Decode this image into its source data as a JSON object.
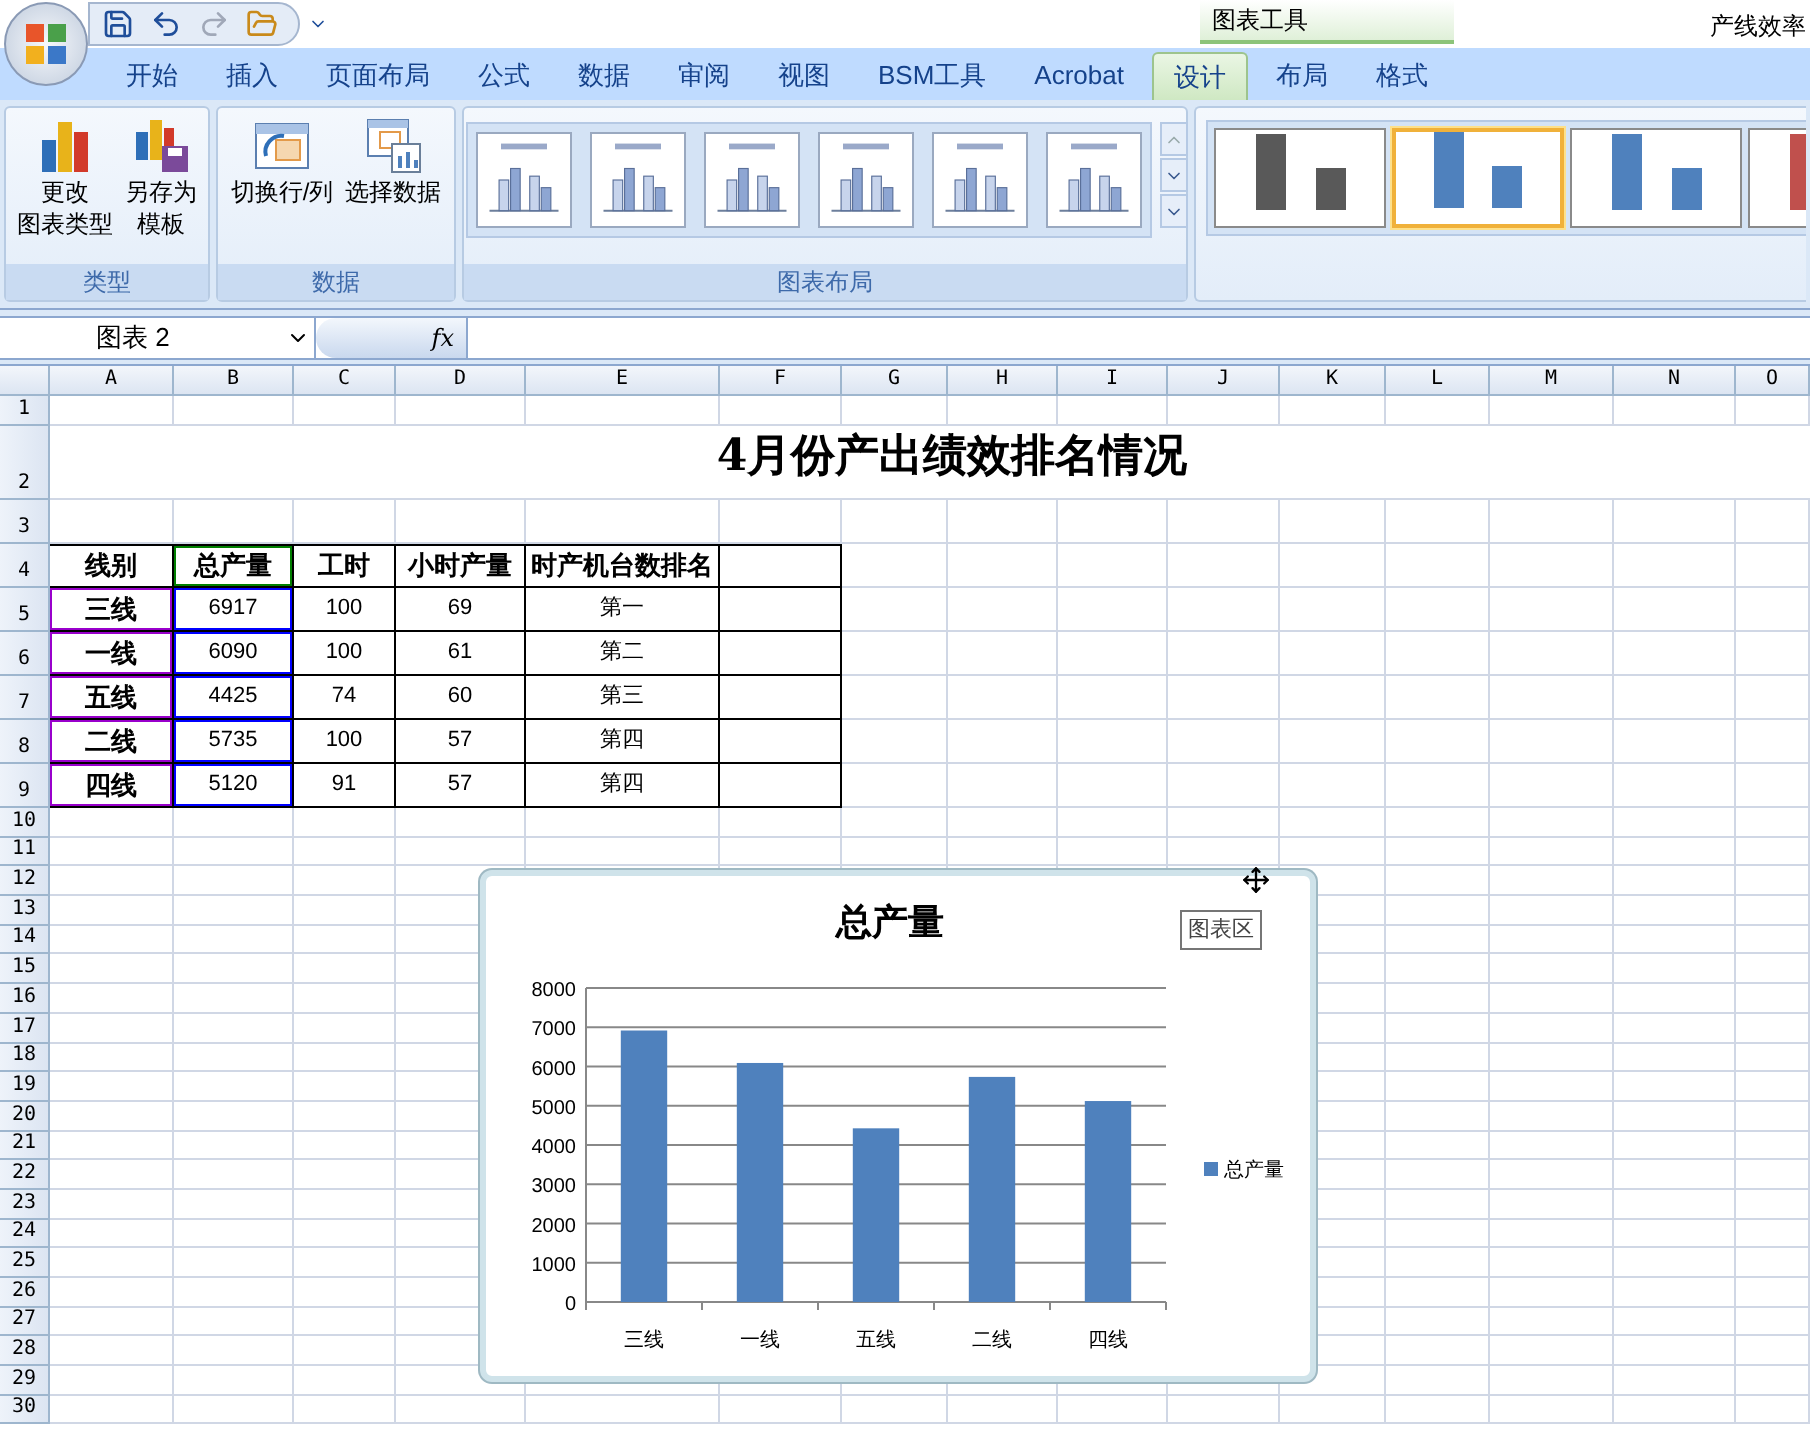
{
  "window": {
    "title": "产线效率",
    "context_tab_group": "图表工具"
  },
  "quick_access": [
    {
      "kind": "save",
      "disabled": false
    },
    {
      "kind": "undo",
      "disabled": false
    },
    {
      "kind": "redo",
      "disabled": true
    },
    {
      "kind": "open",
      "disabled": false
    }
  ],
  "tabs": [
    {
      "label": "开始",
      "selected": false
    },
    {
      "label": "插入",
      "selected": false
    },
    {
      "label": "页面布局",
      "selected": false
    },
    {
      "label": "公式",
      "selected": false
    },
    {
      "label": "数据",
      "selected": false
    },
    {
      "label": "审阅",
      "selected": false
    },
    {
      "label": "视图",
      "selected": false
    },
    {
      "label": "BSM工具",
      "selected": false
    },
    {
      "label": "Acrobat",
      "selected": false
    },
    {
      "label": "设计",
      "selected": true
    },
    {
      "label": "布局",
      "selected": false
    },
    {
      "label": "格式",
      "selected": false
    }
  ],
  "ribbon": {
    "groups": [
      {
        "label": "类型",
        "buttons": [
          {
            "kind": "chart_type",
            "lines": [
              "更改",
              "图表类型"
            ]
          },
          {
            "kind": "save_template",
            "lines": [
              "另存为",
              "模板"
            ]
          }
        ]
      },
      {
        "label": "数据",
        "buttons": [
          {
            "kind": "switch",
            "lines": [
              "切换行/列"
            ]
          },
          {
            "kind": "select_data",
            "lines": [
              "选择数据"
            ]
          }
        ]
      },
      {
        "label": "图表布局"
      }
    ],
    "chart_styles": [
      {
        "color": "#595959",
        "selected": false
      },
      {
        "color": "#4f81bd",
        "selected": true
      },
      {
        "color": "#4f81bd",
        "selected": false
      },
      {
        "color": "#c0504d",
        "selected": false
      }
    ]
  },
  "formula_bar": {
    "name_box": "图表 2",
    "formula_button": "fx"
  },
  "sheet": {
    "columns": [
      "A",
      "B",
      "C",
      "D",
      "E",
      "F",
      "G",
      "H",
      "I",
      "J",
      "K",
      "L",
      "M",
      "N",
      "O"
    ],
    "rows": [
      "1",
      "2",
      "3",
      "4",
      "5",
      "6",
      "7",
      "8",
      "9",
      "10",
      "11",
      "12",
      "13",
      "14",
      "15",
      "16",
      "17",
      "18",
      "19",
      "20",
      "21",
      "22",
      "23",
      "24",
      "25",
      "26",
      "27",
      "28",
      "29",
      "30"
    ],
    "title": "4月份产出绩效排名情况",
    "table": {
      "header": [
        "线别",
        "总产量",
        "工时",
        "小时产量",
        "时产机台数排名"
      ],
      "rows": [
        [
          "三线",
          "6917",
          "100",
          "69",
          "第一"
        ],
        [
          "一线",
          "6090",
          "100",
          "61",
          "第二"
        ],
        [
          "五线",
          "4425",
          "74",
          "60",
          "第三"
        ],
        [
          "二线",
          "5735",
          "100",
          "57",
          "第四"
        ],
        [
          "四线",
          "5120",
          "91",
          "57",
          "第四"
        ]
      ]
    },
    "range_highlights": [
      {
        "kind": "categories",
        "color": "#9900cc"
      },
      {
        "kind": "series_name",
        "color": "#008000"
      },
      {
        "kind": "values",
        "color": "#0000ff"
      }
    ]
  },
  "chart": {
    "tooltip": "图表区",
    "chart_data": {
      "type": "bar",
      "title": "总产量",
      "grid": true,
      "categories": [
        "三线",
        "一线",
        "五线",
        "二线",
        "四线"
      ],
      "series": [
        {
          "name": "总产量",
          "color": "#4f81bd",
          "values": [
            6917,
            6090,
            4425,
            5735,
            5120
          ]
        }
      ],
      "ylim": [
        0,
        8000
      ],
      "yticks": [
        0,
        1000,
        2000,
        3000,
        4000,
        5000,
        6000,
        7000,
        8000
      ]
    }
  }
}
